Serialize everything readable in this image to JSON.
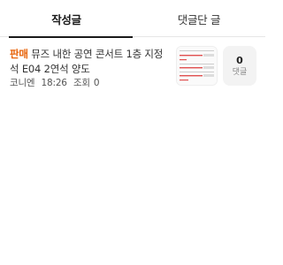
{
  "tabs": {
    "written_posts": "작성글",
    "commented_posts": "댓글단 글"
  },
  "post": {
    "tag": "판매",
    "title": "뮤즈 내한 공연 콘서트 1층 지정석 E04 2연석 양도",
    "author": "코니엔",
    "time": "18:26",
    "views_label": "조회",
    "views": "0",
    "thumbnail_icon": "ticket-screenshot-thumbnail",
    "comments": {
      "count": "0",
      "label": "댓글"
    }
  },
  "colors": {
    "tag": "#e8630a",
    "active_tab_underline": "#1a1a1a",
    "comment_box_bg": "#f3f3f3"
  }
}
